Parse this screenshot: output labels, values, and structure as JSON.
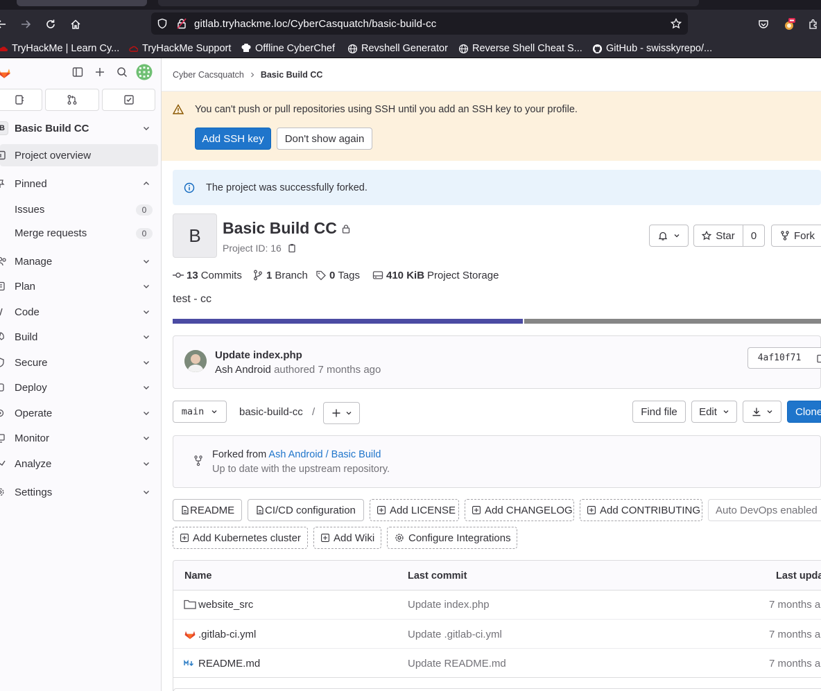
{
  "browser": {
    "url": "gitlab.tryhackme.loc/CyberCasquatch/basic-build-cc",
    "bookmarks": [
      {
        "label": "TryHackMe | Learn Cy..."
      },
      {
        "label": "TryHackMe Support"
      },
      {
        "label": "Offline CyberChef"
      },
      {
        "label": "Revshell Generator"
      },
      {
        "label": "Reverse Shell Cheat S..."
      },
      {
        "label": "GitHub - swisskyrepo/..."
      }
    ]
  },
  "sidebar": {
    "project_initial": "B",
    "project_name": "Basic Build CC",
    "items": {
      "overview": "Project overview",
      "pinned": "Pinned",
      "issues": "Issues",
      "issues_count": "0",
      "merge_requests": "Merge requests",
      "merge_requests_count": "0",
      "manage": "Manage",
      "plan": "Plan",
      "code": "Code",
      "build": "Build",
      "secure": "Secure",
      "deploy": "Deploy",
      "operate": "Operate",
      "monitor": "Monitor",
      "analyze": "Analyze",
      "settings": "Settings"
    }
  },
  "breadcrumb": {
    "group": "Cyber Cacsquatch",
    "project": "Basic Build CC"
  },
  "ssh_alert": {
    "message": "You can't push or pull repositories using SSH until you add an SSH key to your profile.",
    "add_label": "Add SSH key",
    "dismiss_label": "Don't show again"
  },
  "fork_alert": {
    "message": "The project was successfully forked."
  },
  "project": {
    "avatar_letter": "B",
    "title": "Basic Build CC",
    "id_label": "Project ID: 16",
    "star_label": "Star",
    "star_count": "0",
    "fork_label": "Fork",
    "description": "test - cc",
    "language_fill": 0.54,
    "colors": {
      "primary_lang": "#4b4ba3",
      "other_lang": "#868686",
      "accent": "#1f75cb",
      "warning_bg": "#fdf1dd"
    }
  },
  "stats": {
    "commits_num": "13",
    "commits_label": "Commits",
    "branch_num": "1",
    "branch_label": "Branch",
    "tags_num": "0",
    "tags_label": "Tags",
    "storage_num": "410 KiB",
    "storage_label": "Project Storage"
  },
  "last_commit": {
    "title": "Update index.php",
    "author": "Ash Android",
    "meta": "authored 7 months ago",
    "sha": "4af10f71"
  },
  "repo_nav": {
    "branch": "main",
    "path": "basic-build-cc",
    "slash": "/",
    "find_file": "Find file",
    "edit": "Edit",
    "clone": "Clone"
  },
  "fork_info": {
    "prefix": "Forked from",
    "source": "Ash Android / Basic Build",
    "status": "Up to date with the upstream repository."
  },
  "shortcuts": {
    "readme": "README",
    "cicd": "CI/CD configuration",
    "license": "Add LICENSE",
    "changelog": "Add CHANGELOG",
    "contributing": "Add CONTRIBUTING",
    "autodevops": "Auto DevOps enabled",
    "kubernetes": "Add Kubernetes cluster",
    "wiki": "Add Wiki",
    "integrations": "Configure Integrations"
  },
  "file_table": {
    "headers": {
      "name": "Name",
      "commit": "Last commit",
      "updated": "Last upda"
    },
    "rows": [
      {
        "name": "website_src",
        "commit": "Update index.php",
        "updated": "7 months a"
      },
      {
        "name": ".gitlab-ci.yml",
        "commit": "Update .gitlab-ci.yml",
        "updated": "7 months a"
      },
      {
        "name": "README.md",
        "commit": "Update README.md",
        "updated": "7 months a"
      }
    ]
  }
}
